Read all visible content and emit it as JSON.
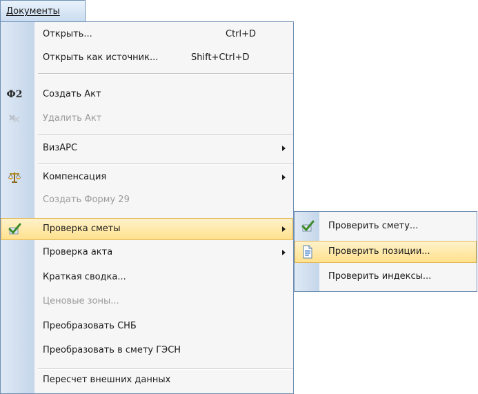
{
  "menu_bar": {
    "title": "Документы"
  },
  "menu": {
    "items": [
      {
        "label": "Открыть...",
        "shortcut": "Ctrl+D"
      },
      {
        "label": "Открыть как источник...",
        "shortcut": "Shift+Ctrl+D"
      },
      {
        "label": "Создать Акт",
        "icon": "f2-icon"
      },
      {
        "label": "Удалить Акт",
        "icon": "delete-act-icon",
        "disabled": true
      },
      {
        "label": "ВизАРС",
        "submenu": true
      },
      {
        "label": "Компенсация",
        "icon": "scales-icon",
        "submenu": true
      },
      {
        "label": "Создать Форму 29",
        "disabled": true
      },
      {
        "label": "Проверка сметы",
        "icon": "checkmark-icon",
        "submenu": true,
        "highlighted": true
      },
      {
        "label": "Проверка акта",
        "submenu": true
      },
      {
        "label": "Краткая сводка..."
      },
      {
        "label": "Ценовые зоны...",
        "disabled": true
      },
      {
        "label": "Преобразовать СНБ"
      },
      {
        "label": "Преобразовать в смету ГЭСН"
      },
      {
        "label": "Пересчет внешних данных"
      }
    ],
    "f2_icon_text": "Ф2"
  },
  "submenu": {
    "items": [
      {
        "label": "Проверить смету...",
        "icon": "checkmark-icon"
      },
      {
        "label": "Проверить позиции...",
        "icon": "document-icon",
        "highlighted": true
      },
      {
        "label": "Проверить индексы..."
      }
    ]
  },
  "colors": {
    "highlight": "#ffe08a",
    "gutter": "#c4d6ea",
    "border": "#6f8fb3",
    "disabled_text": "#9a9a9a"
  }
}
